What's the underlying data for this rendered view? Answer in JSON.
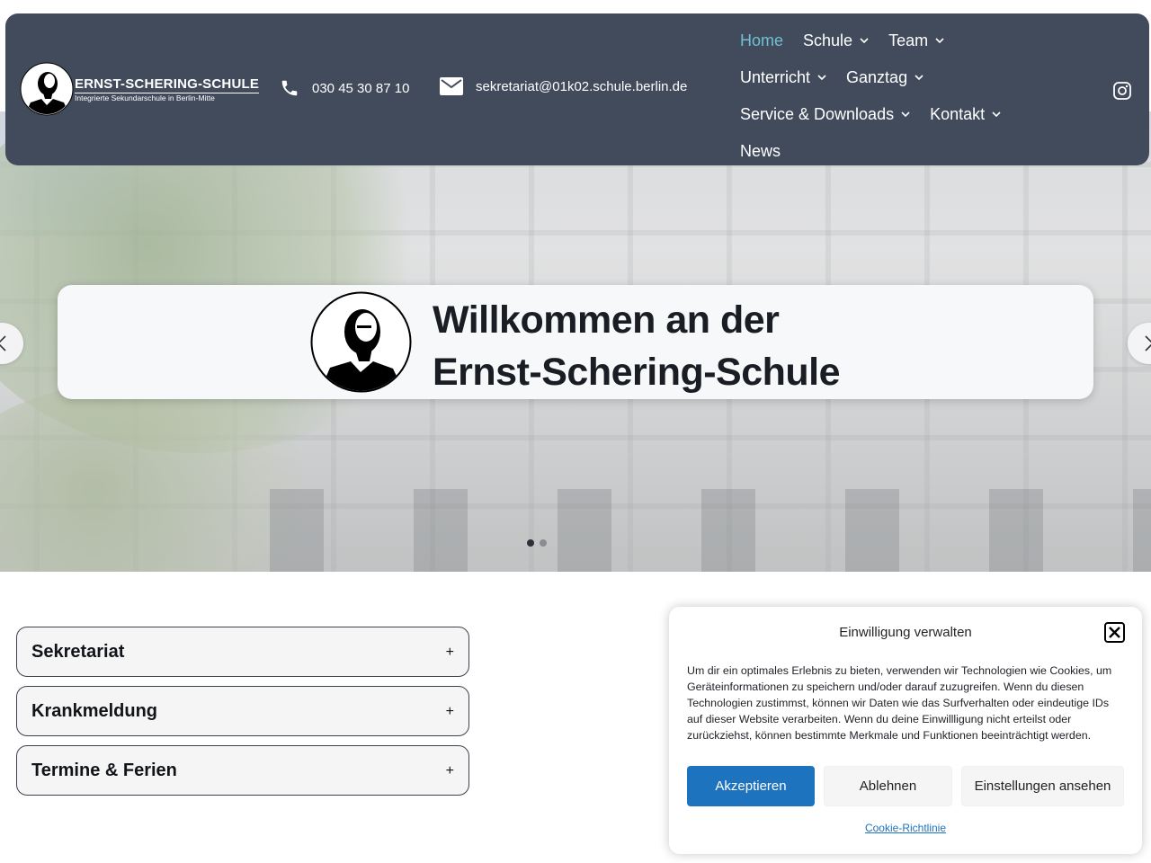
{
  "header": {
    "logo": {
      "name": "ERNST-SCHERING-SCHULE",
      "subtitle": "Integrierte Sekundarschule in Berlin-Mitte"
    },
    "phone": "030 45 30 87 10",
    "email": "sekretariat@01k02.schule.berlin.de",
    "nav": {
      "home": "Home",
      "schule": "Schule",
      "team": "Team",
      "unterricht": "Unterricht",
      "ganztag": "Ganztag",
      "service": "Service & Downloads",
      "kontakt": "Kontakt",
      "news": "News"
    },
    "icons": {
      "phone": "phone-icon",
      "email": "envelope-icon",
      "social": "instagram-icon"
    }
  },
  "hero": {
    "heading_line1": "Willkommen an der",
    "heading_line2": "Ernst-Schering-Schule",
    "slides": 2,
    "active_slide": 1
  },
  "accordion": [
    {
      "label": "Sekretariat"
    },
    {
      "label": "Krankmeldung"
    },
    {
      "label": "Termine & Ferien"
    }
  ],
  "cookie": {
    "title": "Einwilligung verwalten",
    "body": "Um dir ein optimales Erlebnis zu bieten, verwenden wir Technologien wie Cookies, um Geräteinformationen zu speichern und/oder darauf zuzugreifen. Wenn du diesen Technologien zustimmst, können wir Daten wie das Surfverhalten oder eindeutige IDs auf dieser Website verarbeiten. Wenn du deine Einwillligung nicht erteilst oder zurückziehst, können bestimmte Merkmale und Funktionen beeinträchtigt werden.",
    "accept": "Akzeptieren",
    "deny": "Ablehnen",
    "preferences": "Einstellungen ansehen",
    "policy": "Cookie-Richtlinie"
  },
  "colors": {
    "header_bg": "#424b5c",
    "nav_active": "#6fc0d3",
    "accept_button": "#1e73be"
  }
}
